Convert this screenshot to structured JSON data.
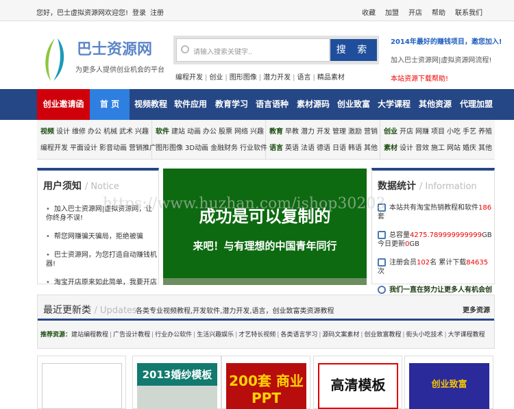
{
  "topbar": {
    "welcome": "您好，巴士虚拟资源网欢迎您!",
    "login": "登录",
    "register": "注册",
    "links": [
      "收藏",
      "加盟",
      "开店",
      "帮助",
      "联系我们"
    ]
  },
  "logo": {
    "title": "巴士资源网",
    "slogan": "为更多人提供创业机会的平台"
  },
  "search": {
    "placeholder": "请输入搜索关键字..",
    "button": "搜 索",
    "hot": [
      "编程开发",
      "创业",
      "图形图像",
      "潜力开发",
      "语言",
      "精品素材"
    ]
  },
  "promo": {
    "headline": "2014年最好的赚钱项目，邀您加入!",
    "line2": "加入巴士资源网|虚拟资源网流程!",
    "line3": "本站资源下载帮助!"
  },
  "nav": [
    "创业邀请函",
    "首 页",
    "视频教程",
    "软件应用",
    "教育学习",
    "语言语种",
    "素材源码",
    "创业致富",
    "大学课程",
    "其他资源",
    "代理加盟"
  ],
  "subnav": [
    {
      "r1h": "视频",
      "r1": [
        "设计",
        "维修",
        "办公",
        "机械",
        "武术",
        "兴趣"
      ],
      "r2h": "",
      "r2": [
        "编程开发",
        "平面设计",
        "影音动画",
        "营销推广"
      ]
    },
    {
      "r1h": "软件",
      "r1": [
        "建站",
        "动画",
        "办公",
        "股票",
        "网络",
        "兴趣"
      ],
      "r2h": "",
      "r2": [
        "图形图像",
        "3D动画",
        "金融财务",
        "行业软件"
      ]
    },
    {
      "r1h": "教育",
      "r1": [
        "早教",
        "潜力",
        "开发",
        "管理",
        "激励",
        "营销"
      ],
      "r2h": "语言",
      "r2": [
        "英语",
        "法语",
        "德语",
        "日语",
        "韩语",
        "其他"
      ]
    },
    {
      "r1h": "创业",
      "r1": [
        "开店",
        "网赚",
        "项目",
        "小吃",
        "手艺",
        "养殖"
      ],
      "r2h": "素材",
      "r2": [
        "设计",
        "音效",
        "施工",
        "网站",
        "婚庆",
        "其他"
      ]
    }
  ],
  "notice": {
    "title": "用户须知",
    "sub": "/ Notice",
    "items": [
      "加入巴士资源网|虚拟资源网，让你终身不误!",
      "帮您网赚骗天骗局，拒绝被骗",
      "巴士资源网，为您打造自动赚钱机器!",
      "淘宝开店原来如此简单，我要开店"
    ]
  },
  "banner": {
    "line1": "成功是可以复制的",
    "line2": "来吧！与有理想的中国青年同行"
  },
  "stats": {
    "title": "数据统计",
    "sub": "/ Information",
    "s1a": "本站共有淘宝热销教程和软件",
    "s1n": "186",
    "s1b": "套",
    "s2a": "总容量",
    "s2n": "4275.789999999999",
    "s2b": "GB 今日更新",
    "s2n2": "0",
    "s2c": "GB",
    "s3a": "注册会员",
    "s3n": "102",
    "s3b": "名 累计下载",
    "s3n2": "84635",
    "s3c": "次",
    "s4": "我们一直在努力让更多人有机会创业"
  },
  "updates": {
    "title": "最近更新类",
    "sub": "/ Updates",
    "desc": "各类专业视频教程,开发软件,潜力开发,语言，创业致富类资源教程",
    "more": "更多资源",
    "rec_label": "推荐资源：",
    "rec": [
      "建站编程教程",
      "广告设计教程",
      "行业办公软件",
      "生活兴趣娱乐",
      "才艺特长视频",
      "各类语言学习",
      "源码文案素材",
      "创业致富教程",
      "街头小吃技术",
      "大学课程教程"
    ]
  },
  "cards": [
    "",
    "2013婚纱模板",
    "200套 商业PPT",
    "高清模板",
    "创业致富"
  ],
  "watermark": "https://www.huzhan.com/ishop30203"
}
